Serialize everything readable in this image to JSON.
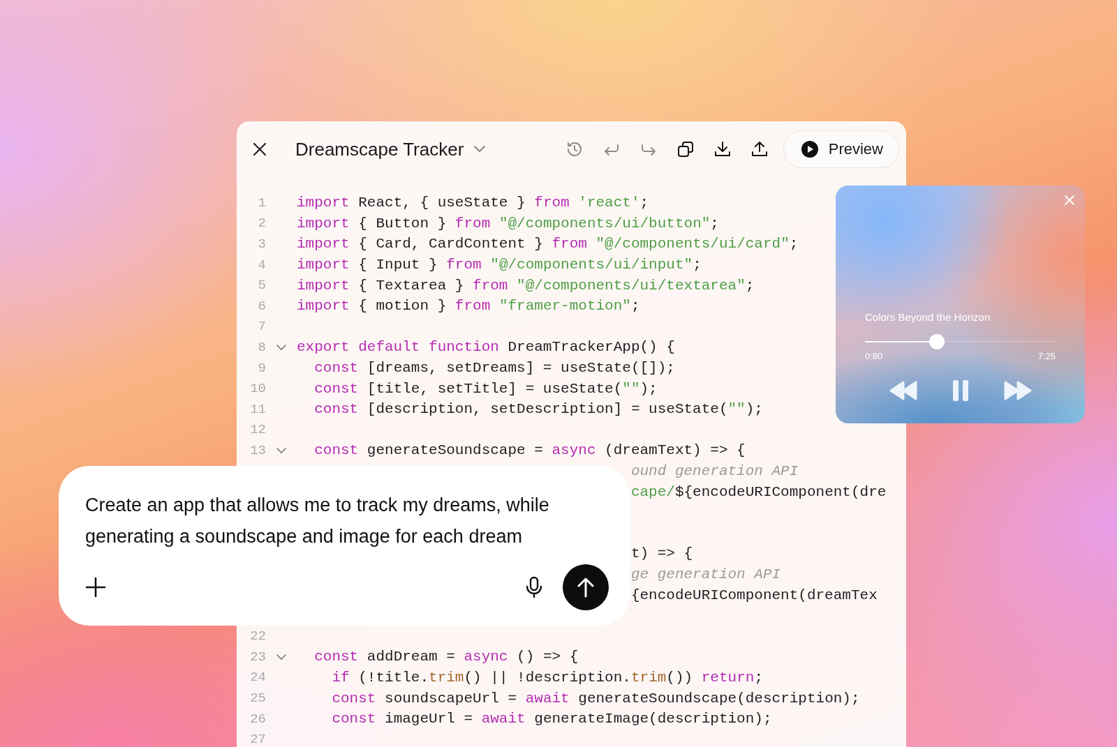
{
  "editor": {
    "title": "Dreamscape Tracker",
    "toolbar": [
      {
        "kind": "history",
        "disabled": true
      },
      {
        "kind": "undo",
        "disabled": true
      },
      {
        "kind": "redo",
        "disabled": true
      },
      {
        "kind": "copy",
        "disabled": false
      },
      {
        "kind": "download",
        "disabled": false
      },
      {
        "kind": "upload",
        "disabled": false
      }
    ],
    "preview_button": "Preview",
    "lines": [
      {
        "number": "1",
        "tokens": [
          {
            "kind": "keyword",
            "text": "import"
          },
          {
            "kind": "plain",
            "text": " React, { useState } "
          },
          {
            "kind": "keyword",
            "text": "from"
          },
          {
            "kind": "string",
            "text": " 'react'"
          },
          {
            "kind": "plain",
            "text": ";"
          }
        ]
      },
      {
        "number": "2",
        "tokens": [
          {
            "kind": "keyword",
            "text": "import"
          },
          {
            "kind": "plain",
            "text": " { Button } "
          },
          {
            "kind": "keyword",
            "text": "from"
          },
          {
            "kind": "string",
            "text": " \"@/components/ui/button\""
          },
          {
            "kind": "plain",
            "text": ";"
          }
        ]
      },
      {
        "number": "3",
        "tokens": [
          {
            "kind": "keyword",
            "text": "import"
          },
          {
            "kind": "plain",
            "text": " { Card, CardContent } "
          },
          {
            "kind": "keyword",
            "text": "from"
          },
          {
            "kind": "string",
            "text": " \"@/components/ui/card\""
          },
          {
            "kind": "plain",
            "text": ";"
          }
        ]
      },
      {
        "number": "4",
        "tokens": [
          {
            "kind": "keyword",
            "text": "import"
          },
          {
            "kind": "plain",
            "text": " { Input } "
          },
          {
            "kind": "keyword",
            "text": "from"
          },
          {
            "kind": "string",
            "text": " \"@/components/ui/input\""
          },
          {
            "kind": "plain",
            "text": ";"
          }
        ]
      },
      {
        "number": "5",
        "tokens": [
          {
            "kind": "keyword",
            "text": "import"
          },
          {
            "kind": "plain",
            "text": " { Textarea } "
          },
          {
            "kind": "keyword",
            "text": "from"
          },
          {
            "kind": "string",
            "text": " \"@/components/ui/textarea\""
          },
          {
            "kind": "plain",
            "text": ";"
          }
        ]
      },
      {
        "number": "6",
        "tokens": [
          {
            "kind": "keyword",
            "text": "import"
          },
          {
            "kind": "plain",
            "text": " { motion } "
          },
          {
            "kind": "keyword",
            "text": "from"
          },
          {
            "kind": "string",
            "text": " \"framer-motion\""
          },
          {
            "kind": "plain",
            "text": ";"
          }
        ]
      },
      {
        "number": "7"
      },
      {
        "number": "8",
        "expanded": true,
        "tokens": [
          {
            "kind": "keyword",
            "text": "export default function"
          },
          {
            "kind": "plain",
            "text": " DreamTrackerApp() {"
          }
        ]
      },
      {
        "number": "9",
        "tokens": [
          {
            "kind": "keyword",
            "text": "  const"
          },
          {
            "kind": "plain",
            "text": " [dreams, setDreams] = useState([]);"
          }
        ]
      },
      {
        "number": "10",
        "tokens": [
          {
            "kind": "keyword",
            "text": "  const"
          },
          {
            "kind": "plain",
            "text": " [title, setTitle] = useState("
          },
          {
            "kind": "string",
            "text": "\"\""
          },
          {
            "kind": "plain",
            "text": ");"
          }
        ]
      },
      {
        "number": "11",
        "tokens": [
          {
            "kind": "keyword",
            "text": "  const"
          },
          {
            "kind": "plain",
            "text": " [description, setDescription] = useState("
          },
          {
            "kind": "string",
            "text": "\"\""
          },
          {
            "kind": "plain",
            "text": ");"
          }
        ]
      },
      {
        "number": "12"
      },
      {
        "number": "13",
        "expanded": true,
        "tokens": [
          {
            "kind": "keyword",
            "text": "  const"
          },
          {
            "kind": "plain",
            "text": " generateSoundscape = "
          },
          {
            "kind": "keyword",
            "text": "async"
          },
          {
            "kind": "plain",
            "text": " (dreamText) => {"
          }
        ]
      },
      {
        "kind": "partial",
        "tokens": [
          {
            "kind": "comment",
            "text": "ound generation API"
          }
        ]
      },
      {
        "kind": "partial",
        "tokens": [
          {
            "kind": "string",
            "text": "cape/"
          },
          {
            "kind": "plain",
            "text": "${encodeURIComponent(dre"
          }
        ]
      },
      {
        "kind": "covered"
      },
      {
        "kind": "covered"
      },
      {
        "kind": "partial",
        "tokens": [
          {
            "kind": "plain",
            "text": "t) => {"
          }
        ]
      },
      {
        "kind": "partial",
        "tokens": [
          {
            "kind": "comment",
            "text": "ge generation API"
          }
        ]
      },
      {
        "kind": "partial",
        "tokens": [
          {
            "kind": "plain",
            "text": "{encodeURIComponent(dreamTex"
          }
        ]
      },
      {
        "kind": "covered"
      },
      {
        "number": "22"
      },
      {
        "number": "23",
        "expanded": true,
        "tokens": [
          {
            "kind": "keyword",
            "text": "  const"
          },
          {
            "kind": "plain",
            "text": " addDream = "
          },
          {
            "kind": "keyword",
            "text": "async"
          },
          {
            "kind": "plain",
            "text": " () => {"
          }
        ]
      },
      {
        "number": "24",
        "tokens": [
          {
            "kind": "keyword",
            "text": "    if"
          },
          {
            "kind": "plain",
            "text": " (!title."
          },
          {
            "kind": "method",
            "text": "trim"
          },
          {
            "kind": "plain",
            "text": "() || !description."
          },
          {
            "kind": "method",
            "text": "trim"
          },
          {
            "kind": "plain",
            "text": "()) "
          },
          {
            "kind": "keyword",
            "text": "return"
          },
          {
            "kind": "plain",
            "text": ";"
          }
        ]
      },
      {
        "number": "25",
        "tokens": [
          {
            "kind": "keyword",
            "text": "    const"
          },
          {
            "kind": "plain",
            "text": " soundscapeUrl = "
          },
          {
            "kind": "keyword",
            "text": "await"
          },
          {
            "kind": "plain",
            "text": " generateSoundscape(description);"
          }
        ]
      },
      {
        "number": "26",
        "tokens": [
          {
            "kind": "keyword",
            "text": "    const"
          },
          {
            "kind": "plain",
            "text": " imageUrl = "
          },
          {
            "kind": "keyword",
            "text": "await"
          },
          {
            "kind": "plain",
            "text": " generateImage(description);"
          }
        ]
      },
      {
        "number": "27"
      }
    ]
  },
  "player": {
    "track_title": "Colors Beyond the Horizon",
    "level": 0.376,
    "elapsed": "0:80",
    "duration": "7:25",
    "playing": true
  },
  "prompt": {
    "text": "Create an app that allows me to track my dreams, while generating a soundscape and image for each dream"
  }
}
